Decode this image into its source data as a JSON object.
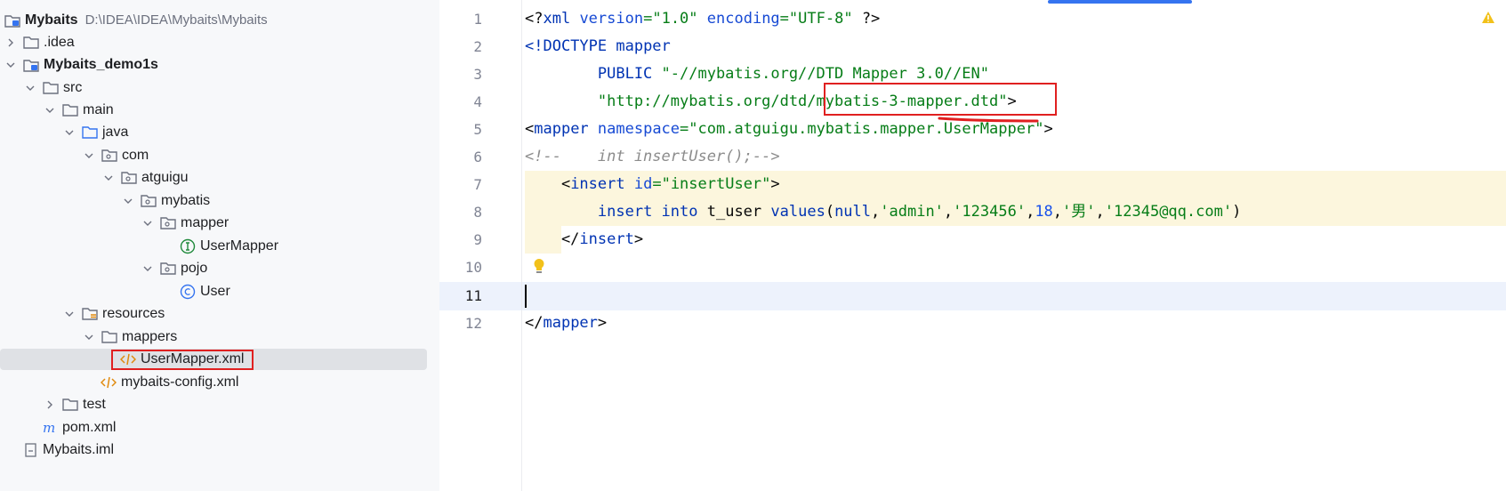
{
  "project": {
    "root_name": "Mybaits",
    "root_path": "D:\\IDEA\\IDEA\\Mybaits\\Mybaits",
    "items": [
      {
        "label": ".idea"
      },
      {
        "label": "Mybaits_demo1s"
      },
      {
        "label": "src"
      },
      {
        "label": "main"
      },
      {
        "label": "java"
      },
      {
        "label": "com"
      },
      {
        "label": "atguigu"
      },
      {
        "label": "mybatis"
      },
      {
        "label": "mapper"
      },
      {
        "label": "UserMapper"
      },
      {
        "label": "pojo"
      },
      {
        "label": "User"
      },
      {
        "label": "resources"
      },
      {
        "label": "mappers"
      },
      {
        "label": "UserMapper.xml"
      },
      {
        "label": "mybaits-config.xml"
      },
      {
        "label": "test"
      },
      {
        "label": "pom.xml"
      },
      {
        "label": "Mybaits.iml"
      }
    ],
    "icons": [
      "folder-icon",
      "module-icon",
      "package-icon",
      "interface-icon",
      "class-icon",
      "xml-file-icon",
      "maven-icon",
      "iml-file-icon"
    ]
  },
  "editor": {
    "line_numbers": [
      "1",
      "2",
      "3",
      "4",
      "5",
      "6",
      "7",
      "8",
      "9",
      "10",
      "11",
      "12"
    ],
    "current_line": "11",
    "tokens": {
      "l1_a": "<?",
      "l1_b": "xml ",
      "l1_c": "version",
      "l1_d": "=",
      "l1_e": "\"1.0\"",
      "l1_f": " ",
      "l1_g": "encoding",
      "l1_h": "=",
      "l1_i": "\"UTF-8\"",
      "l1_j": " ?>",
      "l2_a": "<!DOCTYPE ",
      "l2_b": "mapper",
      "l3_a": "        PUBLIC ",
      "l3_b": "\"-//mybatis.org//DTD Mapper 3.0//EN\"",
      "l4_a": "        ",
      "l4_b": "\"http://mybatis.org/dtd/mybatis-3-mapper.dtd\"",
      "l4_c": ">",
      "l5_a": "<",
      "l5_b": "mapper ",
      "l5_c": "namespace",
      "l5_d": "=",
      "l5_e": "\"com.atguigu.mybatis.mapper.UserMapper\"",
      "l5_f": ">",
      "l6_a": "<!--    int insertUser();-->",
      "l7_a": "    <",
      "l7_b": "insert ",
      "l7_c": "id",
      "l7_d": "=",
      "l7_e": "\"insertUser\"",
      "l7_f": ">",
      "l8_a": "        ",
      "l8_b": "insert ",
      "l8_c": "into ",
      "l8_d": "t_user ",
      "l8_e": "values",
      "l8_f": "(",
      "l8_g": "null",
      "l8_h": ",",
      "l8_i": "'admin'",
      "l8_j": ",",
      "l8_k": "'123456'",
      "l8_l": ",",
      "l8_m": "18",
      "l8_n": ",",
      "l8_o": "'男'",
      "l8_p": ",",
      "l8_q": "'12345@qq.com'",
      "l8_r": ")",
      "l9_a": "    </",
      "l9_b": "insert",
      "l9_c": ">",
      "l12_a": "</",
      "l12_b": "mapper",
      "l12_c": ">"
    }
  },
  "colors": {
    "tree_bg": "#f7f8fa",
    "selection": "#dfe1e5",
    "annotation_red": "#e02020",
    "tag": "#0033b3",
    "string": "#067d17",
    "comment": "#8c8c8c",
    "highlight": "#fcf6dd",
    "caret_line": "#edf2fc"
  }
}
